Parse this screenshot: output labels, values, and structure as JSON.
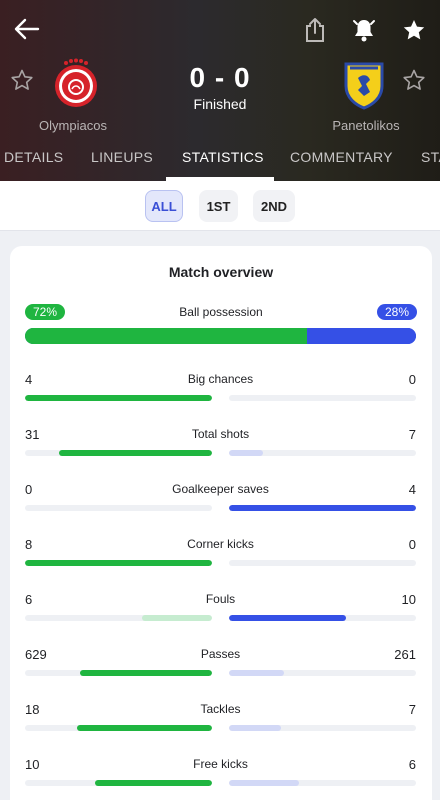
{
  "header": {
    "home_team": "Olympiacos",
    "away_team": "Panetolikos",
    "score": "0 - 0",
    "status": "Finished",
    "icons": {
      "back": "arrow-left-icon",
      "share": "share-icon",
      "bell": "bell-icon",
      "favorite": "star-filled-icon",
      "team_follow": "star-outline-icon"
    }
  },
  "tabs": [
    "DETAILS",
    "LINEUPS",
    "STATISTICS",
    "COMMENTARY",
    "STANDINGS"
  ],
  "active_tab": "STATISTICS",
  "periods": [
    "ALL",
    "1ST",
    "2ND"
  ],
  "active_period": "ALL",
  "colors": {
    "home": "#1fb540",
    "away": "#3550e6",
    "home_weak": "#c6ecd0",
    "away_weak": "#d2d8f6"
  },
  "overview": {
    "title": "Match overview",
    "possession": {
      "label": "Ball possession",
      "home": "72%",
      "away": "28%",
      "home_value": 72,
      "away_value": 28
    },
    "stats": [
      {
        "label": "Big chances",
        "home": "4",
        "away": "0"
      },
      {
        "label": "Total shots",
        "home": "31",
        "away": "7"
      },
      {
        "label": "Goalkeeper saves",
        "home": "0",
        "away": "4"
      },
      {
        "label": "Corner kicks",
        "home": "8",
        "away": "0"
      },
      {
        "label": "Fouls",
        "home": "6",
        "away": "10"
      },
      {
        "label": "Passes",
        "home": "629",
        "away": "261"
      },
      {
        "label": "Tackles",
        "home": "18",
        "away": "7"
      },
      {
        "label": "Free kicks",
        "home": "10",
        "away": "6"
      }
    ]
  }
}
